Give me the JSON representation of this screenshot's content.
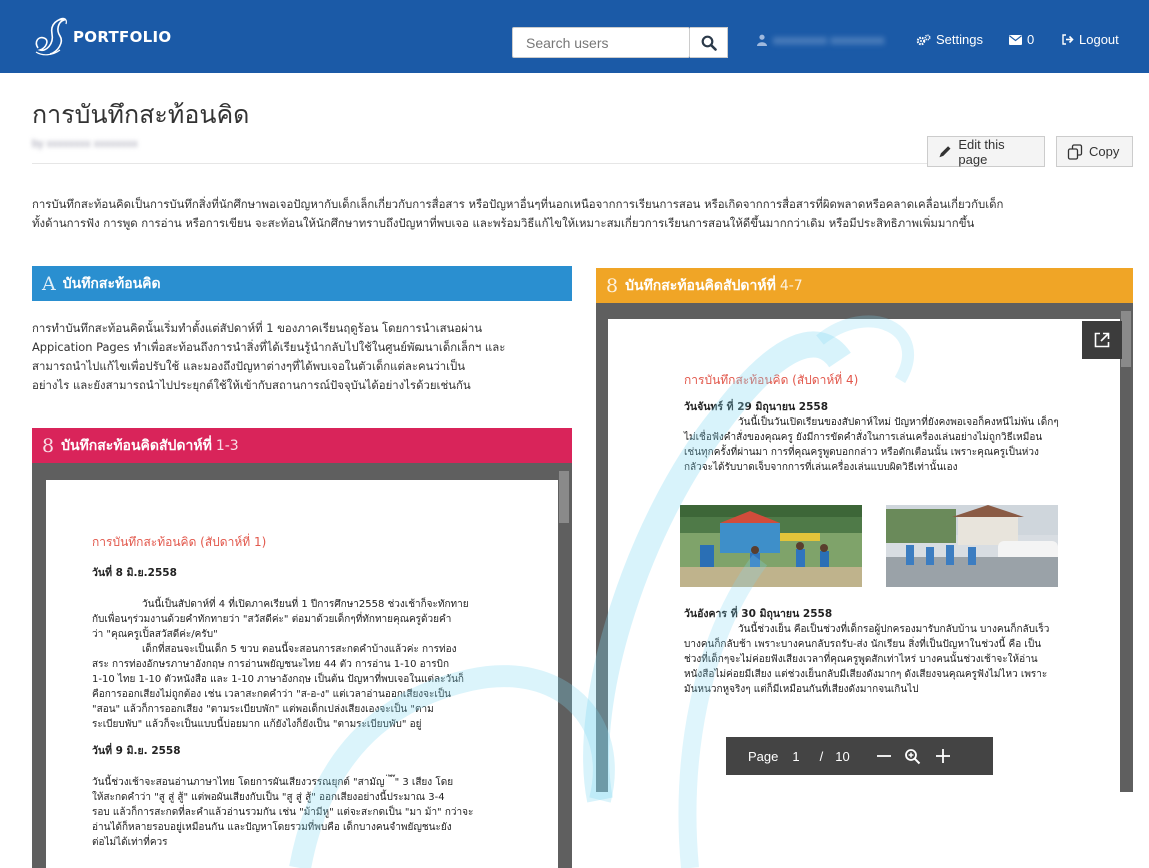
{
  "header": {
    "logo_text": "PORTFOLIO",
    "search_placeholder": "Search users",
    "user_name": "xxxxxxxxx xxxxxxxxx",
    "settings_label": "Settings",
    "messages_count": "0",
    "logout_label": "Logout"
  },
  "page": {
    "title": "การบันทึกสะท้อนคิด",
    "byline": "by xxxxxxxx xxxxxxxx",
    "edit_label": "Edit this page",
    "copy_label": "Copy",
    "intro_1": "การบันทึกสะท้อนคิดเป็นการบันทึกสิ่งที่นักศึกษาพอเจอปัญหากับเด็กเล็กเกี่ยวกับการสื่อสาร หรือปัญหาอื่นๆที่นอกเหนือจากการเรียนการสอน หรือเกิดจากการสื่อสารที่ผิดพลาดหรือคลาดเคลื่อนเกี่ยวกับเด็ก",
    "intro_2": "ทั้งด้านการฟัง การพูด การอ่าน หรือการเขียน จะสะท้อนให้นักศึกษาทราบถึงปัญหาที่พบเจอ และพร้อมวิธีแก้ไขให้เหมาะสมเกี่ยวการเรียนการสอนให้ดีขึ้นมากกว่าเดิม หรือมีประสิทธิภาพเพิ่มมากขึ้น"
  },
  "block_a": {
    "glyph": "A",
    "title": "บันทึกสะท้อนคิด",
    "color": "#2a8fd0",
    "text_1": "การทำบันทึกสะท้อนคิดนั้นเริ่มทำตั้งแต่สัปดาห์ที่ 1 ของภาคเรียนฤดูร้อน โดยการนำเสนอผ่าน",
    "text_2": "Appication Pages ทำเพื่อสะท้อนถึงการนำสิ่งที่ได้เรียนรู้นำกลับไปใช้ในศูนย์พัฒนาเด็กเล็กฯ และ",
    "text_3": "สามารถนำไปแก้ไขเพื่อปรับใช้ และมองถึงปัญหาต่างๆที่ได้พบเจอในตัวเด็กแต่ละคนว่าเป็น",
    "text_4": "อย่างไร และยังสามารถนำไปประยุกต์ใช้ให้เข้ากับสถานการณ์ปัจจุบันได้อย่างไรด้วยเช่นกัน"
  },
  "block_weeks_1_3": {
    "glyph": "8",
    "title": "บันทึกสะท้อนคิดสัปดาห์ที่",
    "range": "1-3",
    "color": "#d9245a",
    "doc": {
      "heading": "การบันทึกสะท้อนคิด (สัปดาห์ที่ 1)",
      "date_1": "วันที่ 8 มิ.ย.2558",
      "p1_1": "วันนี้เป็นสัปดาห์ที่ 4 ที่เปิดภาคเรียนที่ 1 ปีการศึกษา2558 ช่วงเช้าก็จะทักทาย",
      "p1_2": "กับเพื่อนๆร่วมงานด้วยคำทักทายว่า \"สวัสดีค่ะ\" ต่อมาด้วยเด็กๆที่ทักทายคุณครูด้วยคำ",
      "p1_3": "ว่า \"คุณครูเปิ้ลสวัสดีค่ะ/ครับ\"",
      "p2_1": "เด็กที่สอนจะเป็นเด็ก 5 ขวบ ตอนนี้จะสอนการสะกดคำบ้างแล้วค่ะ การท่อง",
      "p2_2": "สระ การท่องอักษรภาษาอังกฤษ การอ่านพยัญชนะไทย 44 ตัว การอ่าน 1-10 อารบิก",
      "p2_3": "1-10 ไทย 1-10 ตัวหนังสือ และ 1-10 ภาษาอังกฤษ เป็นต้น ปัญหาที่พบเจอในแต่ละวันก็",
      "p2_4": "คือการออกเสียงไม่ถูกต้อง เช่น เวลาสะกดคำว่า \"ส-อ-ง\" แต่เวลาอ่านออกเสียงจะเป็น",
      "p2_5": "\"สอน\" แล้วก็การออกเสียง \"ตามระเบียบพัก\" แต่พอเด็กเปล่งเสียงเองจะเป็น \"ตาม",
      "p2_6": "ระเบียบพับ\" แล้วก็จะเป็นแบบนี้บ่อยมาก แก้ยังไงก็ยังเป็น \"ตามระเบียบพับ\" อยู่",
      "date_2": "วันที่ 9 มิ.ย. 2558",
      "p3_1": "วันนี้ช่วงเช้าจะสอนอ่านภาษาไทย โดยการผันเสียงวรรณยุกต์ \"สามัญ ่ ้ ๊\" 3 เสียง โดย",
      "p3_2": "ให้สะกดคำว่า \"สู สู่ สู้\" แต่พอผันเสียงกับเป็น \"สู สู่ สู้\" ออกเสียงอย่างนี้ประมาณ 3-4",
      "p3_3": "รอบ แล้วก็การสะกดที่ละคำแล้วอ่านรวมกัน เช่น \"ม้ามีหู\" แต่จะสะกดเป็น \"มา ม้า\" กว่าจะ",
      "p3_4": "อ่านได้ก็หลายรอบอยู่เหมือนกัน และปัญหาโดยรวมที่พบคือ เด็กบางคนจำพยัญชนะยัง",
      "p3_5": "ต่อไม่ได้เท่าที่ควร"
    }
  },
  "block_weeks_4_7": {
    "glyph": "8",
    "title": "บันทึกสะท้อนคิดสัปดาห์ที่",
    "range": "4-7",
    "color": "#f0a526",
    "doc": {
      "heading": "การบันทึกสะท้อนคิด (สัปดาห์ที่ 4)",
      "date_1": "วันจันทร์ ที่ 29 มิถุนายน 2558",
      "p1_1": "วันนี้เป็นวันเปิดเรียนของสัปดาห์ใหม่ ปัญหาที่ยังคงพอเจอก็คงหนีไม่พ้น เด็กๆ",
      "p1_2": "ไม่เชื่อฟังคำสั่งของคุณครู ยังมีการขัดคำสั่งในการเล่นเครื่องเล่นอย่างไม่ถูกวิธีเหมือน",
      "p1_3": "เช่นทุกครั้งที่ผ่านมา การที่คุณครูพูดบอกกล่าว หรือตักเตือนนั้น เพราะคุณครูเป็นห่วง",
      "p1_4": "กลัวจะได้รับบาดเจ็บจากการที่เล่นเครื่องเล่นแบบผิดวิธีเท่านั้นเอง",
      "date_2": "วันอังคาร ที่ 30 มิถุนายน 2558",
      "p2_1": "วันนี้ช่วงเย็น คือเป็นช่วงที่เด็กรอผู้ปกครองมารับกลับบ้าน บางคนก็กลับเร็ว",
      "p2_2": "บางคนก็กลับช้า เพราะบางคนกลับรถรับ-ส่ง นักเรียน สิ่งที่เป็นปัญหาในช่วงนี้ คือ เป็น",
      "p2_3": "ช่วงที่เด็กๆจะไม่ค่อยฟังเสียงเวลาที่คุณครูพูดสักเท่าไหร่ บางคนนั้นช่วงเช้าจะให้อ่าน",
      "p2_4": "หนังสือไม่ค่อยมีเสียง แต่ช่วงเย็นกลับมีเสียงดังมากๆ ดังเสียงจนคุณครูฟังไม่ไหว เพราะ",
      "p2_5": "มันหนวกหูจริงๆ แต่ก็มีเหมือนกันที่เสียงดังมากจนเกินไป"
    },
    "pager": {
      "label": "Page",
      "current": "1",
      "separator": "/",
      "total": "10"
    }
  },
  "colors": {
    "header_bg": "#1b5aa7",
    "accent_blue": "#2a8fd0",
    "accent_pink": "#d9245a",
    "accent_orange": "#f0a526"
  }
}
